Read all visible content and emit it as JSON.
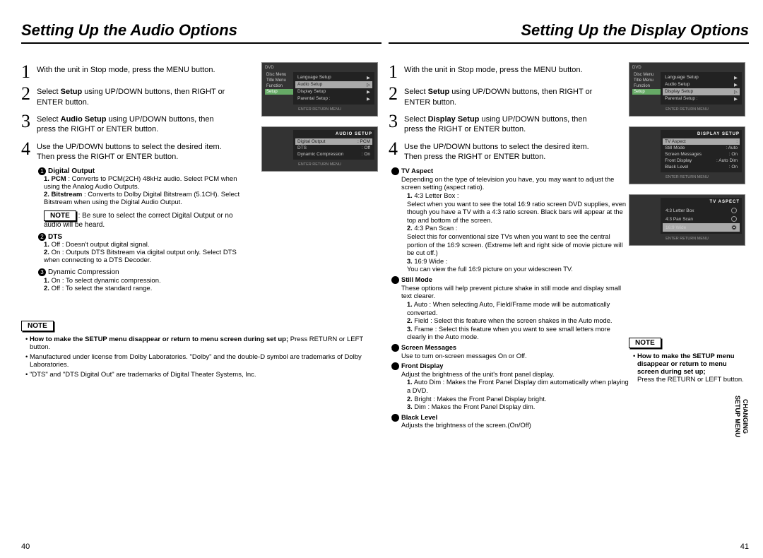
{
  "left": {
    "title": "Setting Up the Audio Options",
    "steps": [
      "With the unit in Stop mode, press the MENU button.",
      "Select <strong>Setup</strong> using UP/DOWN buttons, then RIGHT or ENTER button.",
      "Select <strong>Audio Setup</strong> using UP/DOWN buttons, then press the RIGHT or ENTER button.",
      "Use the UP/DOWN buttons to select the desired item. Then press the RIGHT or ENTER button."
    ],
    "tv1": {
      "side": [
        "Disc Menu",
        "Title Menu",
        "Function",
        "Setup"
      ],
      "rows": [
        {
          "l": "Language Setup",
          "r": "▶",
          "sel": false
        },
        {
          "l": "Audio Setup",
          "r": "▷",
          "sel": true
        },
        {
          "l": "Display Setup",
          "r": "▶",
          "sel": false
        },
        {
          "l": "Parental Setup :",
          "r": "▶",
          "sel": false
        }
      ],
      "bottom": "ENTER   RETURN   MENU"
    },
    "tv2": {
      "title": "AUDIO SETUP",
      "rows": [
        {
          "l": "Digital Output",
          "r": ": PCM",
          "sel": true
        },
        {
          "l": "DTS",
          "r": ": Off",
          "sel": false
        },
        {
          "l": "Dynamic Compression",
          "r": ": On",
          "sel": false
        }
      ],
      "bottom": "ENTER   RETURN   MENU"
    },
    "d1_h": "Digital Output",
    "d1_1": "<strong>1. PCM</strong> : Converts to PCM(2CH) 48kHz audio. Select PCM when using the Analog Audio Outputs.",
    "d1_2": "<strong>2. Bitstream</strong> : Converts to Dolby Digital Bitstream (5.1CH). Select Bitstream when using the Digital Audio Output.",
    "d1_note": ": Be sure to select the correct Digital Output or no audio will be heard.",
    "d2_h": "DTS",
    "d2_1": "<strong>1.</strong> Off : Doesn't output digital signal.",
    "d2_2": "<strong>2.</strong> On : Outputs DTS Bitstream via digital output only. Select DTS when connecting to a DTS Decoder.",
    "d3_h": "Dynamic Compression",
    "d3_1": "<strong>1.</strong> On : To select dynamic compression.",
    "d3_2": "<strong>2.</strong> Off : To select the standard range.",
    "note_label": "NOTE",
    "notes": [
      "<strong>How to make the SETUP menu disappear or return to menu screen during set up;</strong> Press RETURN or LEFT button.",
      "Manufactured under license from Dolby Laboratories. \"Dolby\" and the double-D symbol are trademarks of Dolby Laboratories.",
      "\"DTS\" and \"DTS Digital Out\" are trademarks of Digital Theater Systems, Inc."
    ],
    "page": "40"
  },
  "right": {
    "title": "Setting Up the Display Options",
    "steps": [
      "With the unit in Stop mode, press the MENU button.",
      "Select <strong>Setup</strong> using UP/DOWN buttons, then RIGHT or ENTER button.",
      "Select <strong>Display Setup</strong> using UP/DOWN buttons, then press the RIGHT or ENTER button.",
      "Use the UP/DOWN buttons to select the desired item. Then press the RIGHT or ENTER button."
    ],
    "tv1": {
      "side": [
        "Disc Menu",
        "Title Menu",
        "Function",
        "Setup"
      ],
      "rows": [
        {
          "l": "Language Setup",
          "r": "▶",
          "sel": false
        },
        {
          "l": "Audio Setup",
          "r": "▶",
          "sel": false
        },
        {
          "l": "Display Setup",
          "r": "▷",
          "sel": true
        },
        {
          "l": "Parental Setup :",
          "r": "▶",
          "sel": false
        }
      ],
      "bottom": "ENTER   RETURN   MENU"
    },
    "tv2": {
      "title": "DISPLAY SETUP",
      "rows": [
        {
          "l": "TV Aspect",
          "r": ":",
          "sel": true
        },
        {
          "l": "Still Mode",
          "r": ": Auto",
          "sel": false
        },
        {
          "l": "Screen Messages",
          "r": ": On",
          "sel": false
        },
        {
          "l": "Front Display",
          "r": ": Auto Dim",
          "sel": false
        },
        {
          "l": "Black Level",
          "r": ": On",
          "sel": false
        }
      ],
      "bottom": "ENTER   RETURN   MENU"
    },
    "tv3": {
      "title": "TV ASPECT",
      "options": [
        {
          "l": "4:3 Letter Box",
          "sel": false
        },
        {
          "l": "4:3 Pan Scan",
          "sel": false
        },
        {
          "l": "16:9 Wide",
          "sel": true
        }
      ],
      "bottom": "ENTER   RETURN   MENU"
    },
    "items": [
      {
        "n": "1",
        "h": "TV Aspect",
        "body": "Depending on the type of television you have, you may want to adjust the screen setting (aspect ratio).",
        "subs": [
          "<strong>1.</strong> 4:3 Letter Box :<br>Select when you want to see the total 16:9 ratio screen DVD supplies, even though you have a TV with a 4:3 ratio screen. Black bars will appear at the top and bottom of the screen.",
          "<strong>2.</strong> 4:3 Pan Scan :<br>Select this for conventional size TVs when you want to see the central portion of the 16:9 screen. (Extreme left and right side of movie picture will be cut off.)",
          "<strong>3.</strong> 16:9 Wide :<br>You can view the full 16:9 picture on your widescreen TV."
        ]
      },
      {
        "n": "2",
        "h": "Still Mode",
        "body": "These options will help prevent picture shake in still mode and display small text clearer.",
        "subs": [
          "<strong>1.</strong> Auto : When selecting Auto, Field/Frame mode will be automatically converted.",
          "<strong>2.</strong> Field : Select this feature when the screen shakes in the Auto mode.",
          "<strong>3.</strong> Frame : Select this feature when you want to see small letters more clearly in the Auto mode."
        ]
      },
      {
        "n": "3",
        "h": "Screen Messages",
        "body": "Use to turn on-screen messages On or Off."
      },
      {
        "n": "4",
        "h": "Front Display",
        "body": "Adjust the brightness of the unit's front panel display.",
        "subs": [
          "<strong>1.</strong> Auto Dim : Makes the Front Panel Display dim automatically when playing a DVD.",
          "<strong>2.</strong> Bright : Makes the Front Panel Display bright.",
          "<strong>3.</strong> Dim : Makes the Front Panel Display dim."
        ]
      },
      {
        "n": "5",
        "h": "Black Level",
        "body": "Adjusts the brightness of the screen.(On/Off)"
      }
    ],
    "note_label": "NOTE",
    "note_body": "<strong>How to make the SETUP menu disappear or return to menu screen during set up;</strong><br>Press the RETURN or LEFT button.",
    "side_tab": "CHANGING\nSETUP MENU",
    "page": "41"
  }
}
